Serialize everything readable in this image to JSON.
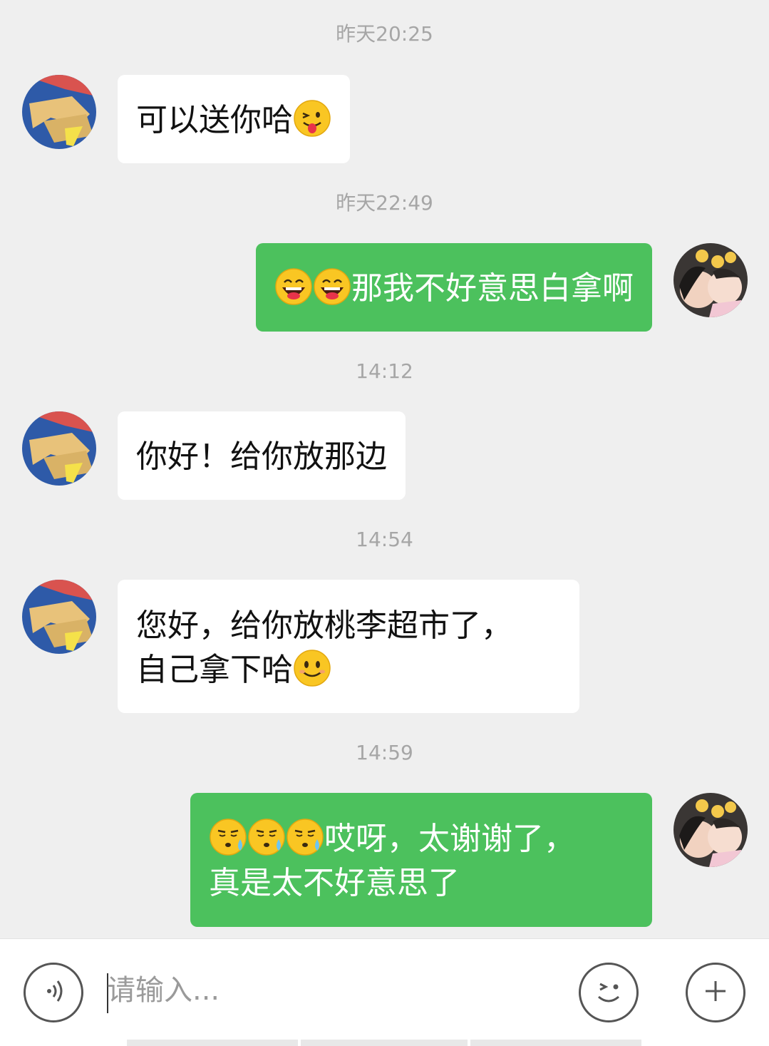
{
  "chat": {
    "messages": [
      {
        "timestamp": "昨天20:25",
        "side": "in",
        "lines": [
          {
            "text": "可以送你哈",
            "emoji_after": [
              "tongue-wink-emoji"
            ]
          }
        ]
      },
      {
        "timestamp": "昨天22:49",
        "side": "out",
        "lines": [
          {
            "emoji_before": [
              "big-grin-emoji",
              "big-grin-emoji"
            ],
            "text": "那我不好意思白拿啊"
          }
        ]
      },
      {
        "timestamp": "14:12",
        "side": "in",
        "lines": [
          {
            "text": "你好！给你放那边"
          }
        ]
      },
      {
        "timestamp": "14:54",
        "side": "in",
        "lines": [
          {
            "text": "您好，给你放桃李超市了，"
          },
          {
            "text": "自己拿下哈",
            "emoji_after": [
              "smile-emoji"
            ]
          }
        ]
      },
      {
        "timestamp": "14:59",
        "side": "out",
        "lines": [
          {
            "emoji_before": [
              "sweat-emoji",
              "sweat-emoji",
              "sweat-emoji"
            ],
            "text": "哎呀，太谢谢了，"
          },
          {
            "text": "真是太不好意思了"
          }
        ]
      }
    ]
  },
  "input_bar": {
    "placeholder": "请输入...",
    "voice_icon": "voice-icon",
    "emoji_icon": "emoji-icon",
    "plus_icon": "plus-icon"
  },
  "colors": {
    "background": "#efefef",
    "outgoing_bubble": "#4cc15d",
    "incoming_bubble": "#ffffff",
    "timestamp": "#a6a6a6"
  }
}
